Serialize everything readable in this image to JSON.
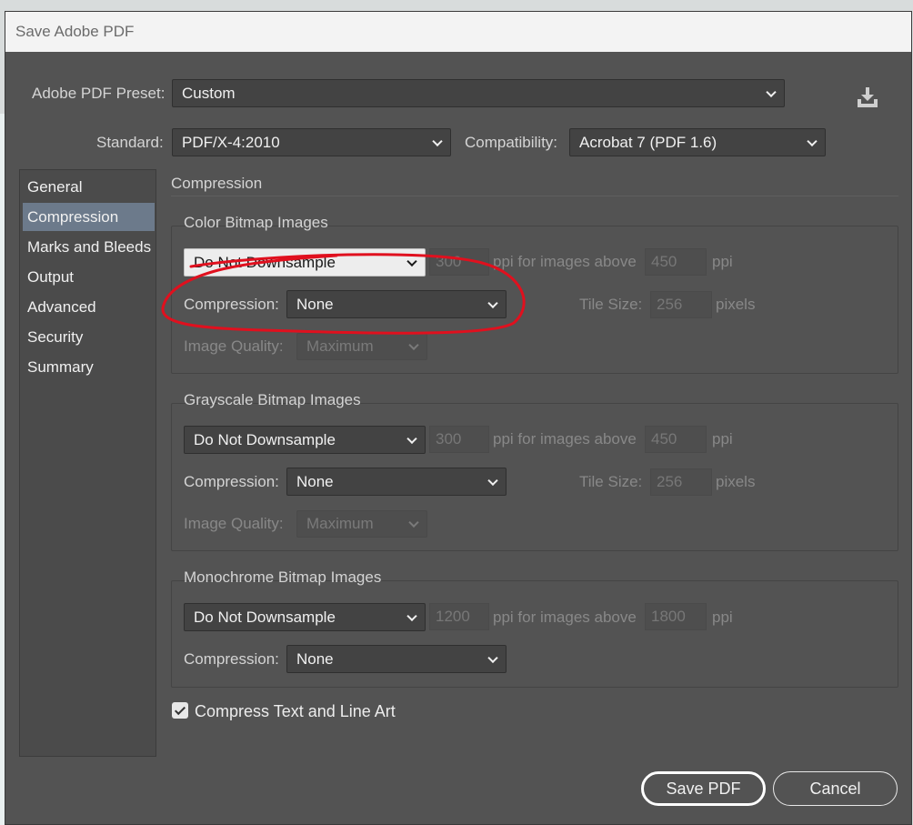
{
  "window": {
    "title": "Save Adobe PDF"
  },
  "preset": {
    "label": "Adobe PDF Preset:",
    "value": "Custom"
  },
  "standard": {
    "label": "Standard:",
    "value": "PDF/X-4:2010"
  },
  "compatibility": {
    "label": "Compatibility:",
    "value": "Acrobat 7 (PDF 1.6)"
  },
  "sidebar": {
    "items": [
      {
        "label": "General"
      },
      {
        "label": "Compression"
      },
      {
        "label": "Marks and Bleeds"
      },
      {
        "label": "Output"
      },
      {
        "label": "Advanced"
      },
      {
        "label": "Security"
      },
      {
        "label": "Summary"
      }
    ],
    "active_index": 1
  },
  "section_title": "Compression",
  "color": {
    "title": "Color Bitmap Images",
    "downsample": "Do Not Downsample",
    "ppi": "300",
    "ppi_text": "ppi for images above",
    "above": "450",
    "ppi_unit": "ppi",
    "compression_label": "Compression:",
    "compression": "None",
    "tile_label": "Tile Size:",
    "tile": "256",
    "tile_unit": "pixels",
    "quality_label": "Image Quality:",
    "quality": "Maximum"
  },
  "gray": {
    "title": "Grayscale Bitmap Images",
    "downsample": "Do Not Downsample",
    "ppi": "300",
    "ppi_text": "ppi for images above",
    "above": "450",
    "ppi_unit": "ppi",
    "compression_label": "Compression:",
    "compression": "None",
    "tile_label": "Tile Size:",
    "tile": "256",
    "tile_unit": "pixels",
    "quality_label": "Image Quality:",
    "quality": "Maximum"
  },
  "mono": {
    "title": "Monochrome Bitmap Images",
    "downsample": "Do Not Downsample",
    "ppi": "1200",
    "ppi_text": "ppi for images above",
    "above": "1800",
    "ppi_unit": "ppi",
    "compression_label": "Compression:",
    "compression": "None"
  },
  "compress_text": {
    "label": "Compress Text and Line Art",
    "checked": true
  },
  "buttons": {
    "save": "Save PDF",
    "cancel": "Cancel"
  },
  "colors": {
    "dialog_bg": "#535353",
    "selected_item": "#6c7a8b",
    "annotation": "#e0101e"
  },
  "icons": {
    "save_preset": "save-download-icon",
    "chevron": "chevron-down-icon",
    "check": "checkmark-icon"
  }
}
